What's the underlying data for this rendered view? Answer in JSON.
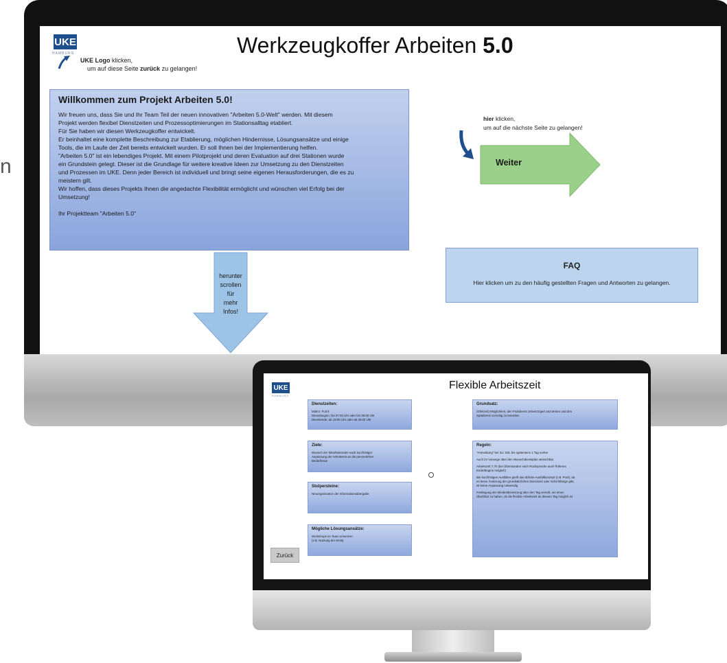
{
  "main_page": {
    "logo_text": "UKE",
    "logo_sub": "HAMBURG",
    "title_plain": "Werkzeugkoffer Arbeiten ",
    "title_bold": "5.0",
    "logo_hint": {
      "bold": "UKE Logo",
      "line1_rest": " klicken,",
      "line2_a": "um auf diese Seite ",
      "line2_bold": "zurück",
      "line2_b": " zu gelangen!"
    },
    "welcome": {
      "heading": "Willkommen zum Projekt Arbeiten 5.0!",
      "lines": [
        "Wir freuen uns, dass Sie und Ihr Team Teil der neuen innovativen \"Arbeiten 5.0-Welt\" werden. Mit diesem",
        "Projekt werden flexibel Dienstzeiten und Prozessoptimierungen im Stationsalltag etabliert.",
        "Für Sie haben wir diesen Werkzeugkoffer entwickelt.",
        "Er beinhaltet eine komplette Beschreibung zur Etablierung, möglichen Hindernisse, Lösungsansätze und einige",
        "Tools, die im Laufe der Zeit bereits entwickelt wurden. Er soll Ihnen bei der Implementierung helfen.",
        "\"Arbeiten 5.0\" ist ein lebendiges Projekt. Mit einem Pilotprojekt und deren Evaluation auf drei Stationen wurde",
        "ein Grundstein gelegt. Dieser ist die Grundlage für weitere kreative Ideen zur Umsetzung zu den Dienstzeiten",
        "und Prozessen im UKE. Denn jeder Bereich ist individuell und bringt seine eigenen Herausforderungen, die es zu",
        "meistern gilt.",
        "Wir hoffen, dass dieses Projekts Ihnen die angedachte Flexibilität ermöglicht und wünschen viel Erfolg bei der",
        "Umsetzung!"
      ],
      "signature": "Ihr Projektteam \"Arbeiten 5.0\""
    },
    "next_hint": {
      "bold": "hier",
      "line1_rest": " klicken,",
      "line2": "um auf die nächste Seite zu gelangen!"
    },
    "next_button": "Weiter",
    "faq": {
      "title": "FAQ",
      "text": "Hier klicken um zu den häufig gestellten Fragen und Antworten zu gelangen."
    },
    "scroll_hint": [
      "herunter",
      "scrollen",
      "für",
      "mehr",
      "Infos!"
    ],
    "partial_left_letter": "n"
  },
  "second_page": {
    "logo_text": "UKE",
    "logo_sub": "HAMBURG",
    "title": "Flexible Arbeitszeit",
    "cards_left": [
      {
        "heading": "Dienstzeiten:",
        "lines": [
          "Makro: FLEX",
          "Dienstbeginn: bis 07:00 Uhr oder bis 08:00 Uhr",
          "Dienstende: ab 19:00 Uhr oder ab 20:00 Uhr"
        ]
      },
      {
        "heading": "Ziele:",
        "lines": [
          "Wunsch der Mitarbeitenden nach kurzfristiger",
          "Anpassung der Arbeitszeit an die persönlichen",
          "Bedürfnisse"
        ]
      },
      {
        "heading": "Stolpersteine:",
        "lines": [
          "Neuorganisation der Informationsübergabe"
        ]
      },
      {
        "heading": "Mögliche Lösungsansätze:",
        "lines": [
          "Workshops im Team umsetzen",
          "(z.B. Nutzung der MAB)"
        ]
      }
    ],
    "grundsatz": {
      "heading": "Grundsatz:",
      "lines": [
        "(Gleitzeit) Möglichkeit, den Frühdienst zeitverzögert anzutreten und den",
        "Spätdienst vorzeitig zu beenden"
      ]
    },
    "regeln": {
      "heading": "Regeln:",
      "paragraphs": [
        [
          "\"Anmeldung\" bei SL/ SSL bis spätestens 1 Tag vorher"
        ],
        [
          "Auch im Vorwege über den Wunschdienstplan wünschbar"
        ],
        [
          "Arbeitszeit 7,7h (bei Überstunden nach Rücksprache auch früheres",
          "Ende/Beginn möglich)"
        ],
        [
          "Bei kurzfristigen Ausfällen greift das übliche Ausfallkonzept (z.B. Pool), da",
          "es keine Änderung der grundsätzlichen Dienstzeit oder Schichtlänge gibt,",
          "ist keine Anpassung notwendig"
        ],
        [
          "Festlegung der Mindestbesetzung über den Tag verteilt, um einen",
          "Überblick zu haben, ob die flexible Arbeitszeit an diesem Tag möglich ist"
        ]
      ]
    },
    "back_button": "Zurück"
  },
  "colors": {
    "uke_blue": "#1f4e8c",
    "box_blue": "#8aa4dc",
    "arrow_green": "#9bd08a",
    "faq_blue": "#bcd4ee",
    "arrow_light_blue": "#9dc3e6"
  }
}
